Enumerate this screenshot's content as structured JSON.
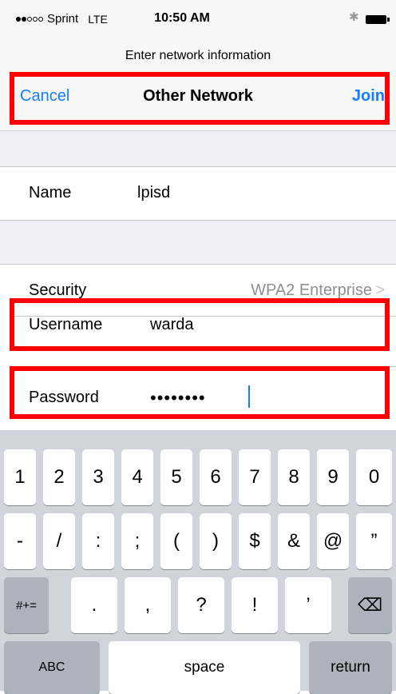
{
  "status_bar": {
    "carrier": "Sprint",
    "network": "LTE",
    "time": "10:50 AM",
    "signal_bars": 2,
    "signal_total": 5,
    "bluetooth_icon": "bluetooth-icon",
    "battery_icon": "battery-icon"
  },
  "prompt": "Enter network information",
  "nav": {
    "cancel": "Cancel",
    "title": "Other Network",
    "join": "Join"
  },
  "form": {
    "name_label": "Name",
    "name_value": "lpisd",
    "security_label": "Security",
    "security_value": "WPA2 Enterprise",
    "security_chevron": ">",
    "username_label": "Username",
    "username_value": "warda",
    "password_label": "Password",
    "password_masked": "••••••••"
  },
  "keyboard": {
    "row1": [
      "1",
      "2",
      "3",
      "4",
      "5",
      "6",
      "7",
      "8",
      "9",
      "0"
    ],
    "row2": [
      "-",
      "/",
      ":",
      ";",
      "(",
      ")",
      "$",
      "&",
      "@",
      "”"
    ],
    "row3_toggle": "#+=",
    "row3": [
      ".",
      ",",
      "?",
      "!",
      "’"
    ],
    "backspace": "⌫",
    "abc": "ABC",
    "space": "space",
    "return": "return"
  },
  "colors": {
    "accent": "#147efb",
    "highlight": "#ff0000",
    "group_bg": "#efeff4",
    "keyboard_bg": "#d1d5db"
  }
}
